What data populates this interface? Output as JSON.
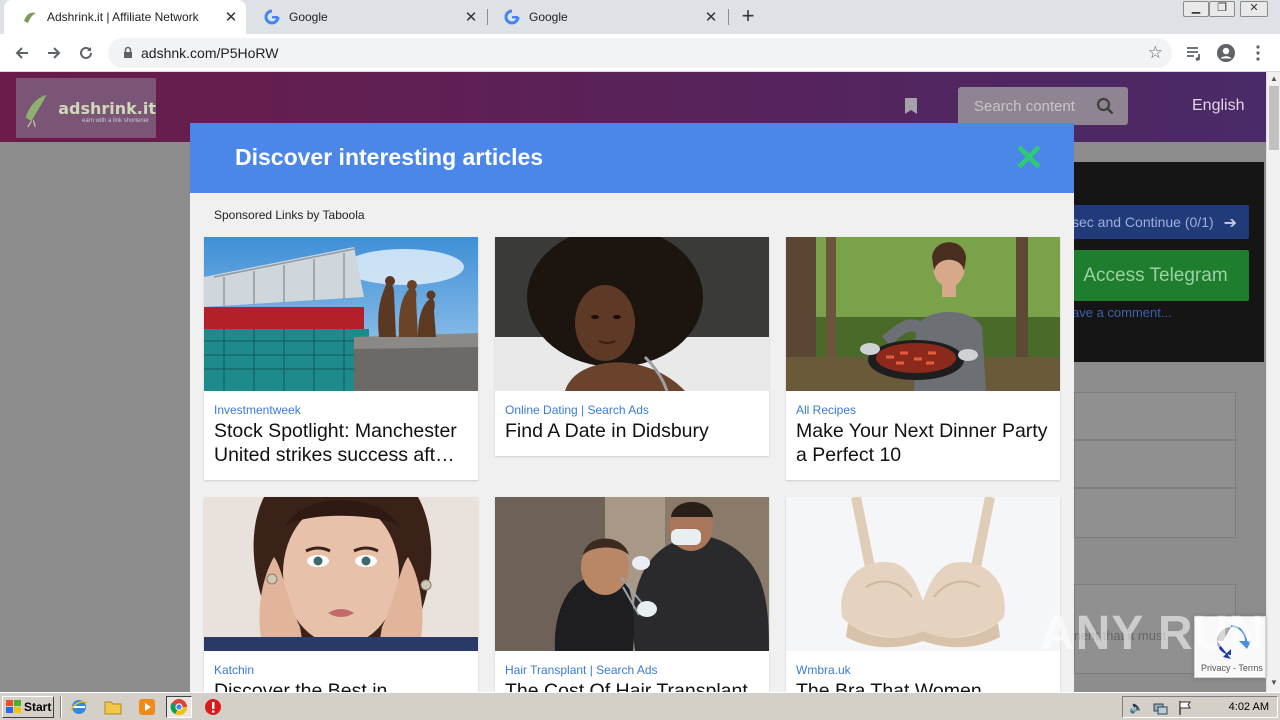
{
  "browser": {
    "tabs": [
      {
        "title": "Adshrink.it | Affiliate Network",
        "active": true
      },
      {
        "title": "Google",
        "active": false
      },
      {
        "title": "Google",
        "active": false
      }
    ],
    "url": "adshnk.com/P5HoRW"
  },
  "site": {
    "logo_text": "adshrink.it",
    "logo_sub": "earn with a link shortener",
    "search_placeholder": "Search content",
    "language": "English",
    "continue_label": "sec and Continue (0/1)",
    "telegram_label": "Access Telegram",
    "comment_link": "ave a comment...",
    "side_text": "ment that it must"
  },
  "modal": {
    "title": "Discover interesting articles",
    "sponsored": "Sponsored Links by Taboola",
    "cards": [
      {
        "source": "Investmentweek",
        "headline": "Stock Spotlight: Manchester United strikes success aft…"
      },
      {
        "source": "Online Dating | Search Ads",
        "headline": "Find A Date in Didsbury"
      },
      {
        "source": "All Recipes",
        "headline": "Make Your Next Dinner Party a Perfect 10"
      },
      {
        "source": "Katchin",
        "headline": "Discover the Best in"
      },
      {
        "source": "Hair Transplant | Search Ads",
        "headline": "The Cost Of Hair Transplant"
      },
      {
        "source": "Wmbra.uk",
        "headline": "The Bra That Women"
      }
    ]
  },
  "overlay": {
    "watermark": "ANY RUN",
    "recaptcha_label": "Privacy - Terms"
  },
  "taskbar": {
    "start_label": "Start",
    "clock": "4:02 AM"
  },
  "colors": {
    "modal_header": "#4a87e8",
    "close_x": "#2ecc71",
    "source_link": "#3a7bd5"
  }
}
